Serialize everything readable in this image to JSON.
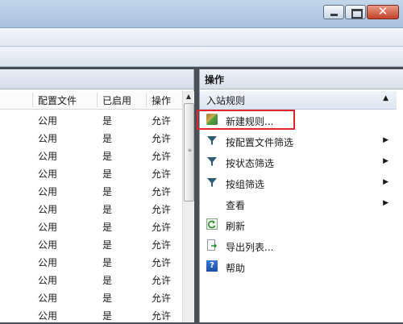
{
  "window": {
    "minimize_label": "",
    "maximize_label": "",
    "close_glyph": "✕"
  },
  "table": {
    "headers": [
      "配置文件",
      "已启用",
      "操作"
    ],
    "rows": [
      [
        "公用",
        "是",
        "允许"
      ],
      [
        "公用",
        "是",
        "允许"
      ],
      [
        "公用",
        "是",
        "允许"
      ],
      [
        "公用",
        "是",
        "允许"
      ],
      [
        "公用",
        "是",
        "允许"
      ],
      [
        "公用",
        "是",
        "允许"
      ],
      [
        "公用",
        "是",
        "允许"
      ],
      [
        "公用",
        "是",
        "允许"
      ],
      [
        "公用",
        "是",
        "允许"
      ],
      [
        "公用",
        "是",
        "允许"
      ],
      [
        "公用",
        "是",
        "允许"
      ],
      [
        "公用",
        "是",
        "允许"
      ]
    ]
  },
  "actions_pane": {
    "title": "操作",
    "section": "入站规则",
    "items": [
      {
        "label": "新建规则...",
        "icon": "new-rule-icon"
      },
      {
        "label": "按配置文件筛选",
        "icon": "filter-icon"
      },
      {
        "label": "按状态筛选",
        "icon": "filter-icon"
      },
      {
        "label": "按组筛选",
        "icon": "filter-icon"
      },
      {
        "label": "查看",
        "icon": ""
      },
      {
        "label": "刷新",
        "icon": "refresh-icon"
      },
      {
        "label": "导出列表...",
        "icon": "export-icon"
      },
      {
        "label": "帮助",
        "icon": "help-icon"
      }
    ]
  },
  "colors": {
    "highlight": "#e1252c",
    "titlebar": "#b3c9e2",
    "close_button": "#c2432a"
  }
}
